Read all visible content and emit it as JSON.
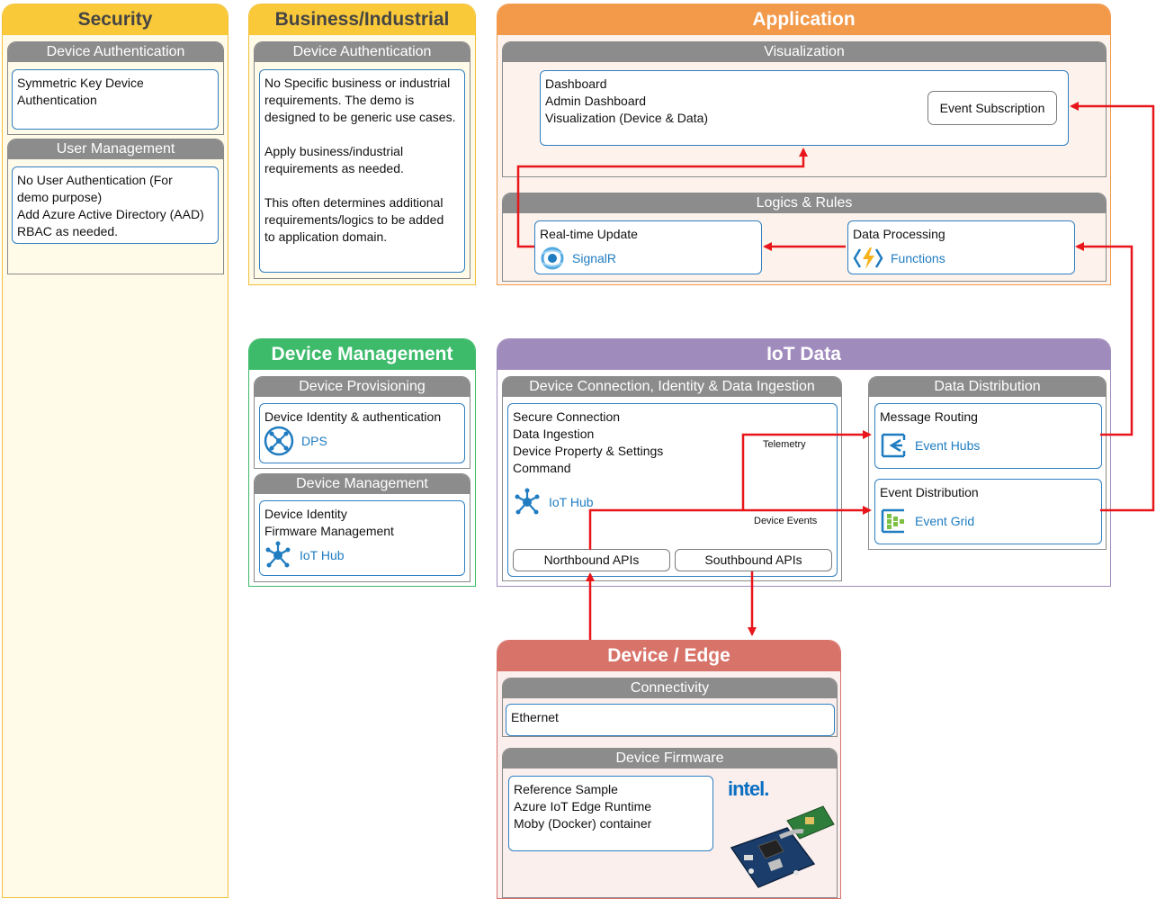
{
  "security": {
    "title": "Security",
    "device_auth": {
      "title": "Device Authentication",
      "lines": [
        "Symmetric Key Device",
        "Authentication"
      ]
    },
    "user_mgmt": {
      "title": "User Management",
      "lines": [
        "No User Authentication (For",
        "demo purpose)",
        "Add Azure Active Directory (AAD)",
        "RBAC as needed."
      ]
    }
  },
  "business": {
    "title": "Business/Industrial",
    "section_title": "Device Authentication",
    "para1": [
      "No Specific business or industrial",
      "requirements.  The demo is",
      "designed to be generic use cases."
    ],
    "para2": [
      "Apply business/industrial",
      "requirements as needed."
    ],
    "para3": [
      "This often determines additional",
      "requirements/logics to be added",
      "to application domain."
    ]
  },
  "application": {
    "title": "Application",
    "visualization": {
      "title": "Visualization",
      "lines": [
        "Dashboard",
        "Admin Dashboard",
        "Visualization (Device & Data)"
      ],
      "event_subscription": "Event Subscription"
    },
    "logics": {
      "title": "Logics & Rules",
      "realtime": {
        "title": "Real-time Update",
        "service": "SignalR"
      },
      "processing": {
        "title": "Data Processing",
        "service": "Functions"
      }
    }
  },
  "device_management": {
    "title": "Device Management",
    "provisioning": {
      "title": "Device Provisioning",
      "line": "Device Identity & authentication",
      "service": "DPS"
    },
    "management": {
      "title": "Device Management",
      "lines": [
        "Device Identity",
        "Firmware Management"
      ],
      "service": "IoT Hub"
    }
  },
  "iot_data": {
    "title": "IoT Data",
    "ingestion": {
      "title": "Device Connection, Identity & Data Ingestion",
      "lines": [
        "Secure Connection",
        "Data Ingestion",
        "Device Property & Settings",
        "Command"
      ],
      "service": "IoT Hub",
      "northbound": "Northbound APIs",
      "southbound": "Southbound APIs",
      "telemetry_label": "Telemetry",
      "device_events_label": "Device Events"
    },
    "distribution": {
      "title": "Data Distribution",
      "routing": {
        "title": "Message Routing",
        "service": "Event Hubs"
      },
      "distribution": {
        "title": "Event Distribution",
        "service": "Event Grid"
      }
    }
  },
  "device_edge": {
    "title": "Device / Edge",
    "connectivity": {
      "title": "Connectivity",
      "line": "Ethernet"
    },
    "firmware": {
      "title": "Device Firmware",
      "lines": [
        "Reference Sample",
        "Azure IoT Edge Runtime",
        "Moby (Docker) container"
      ],
      "logo_text": "intel."
    }
  },
  "colors": {
    "security_header": "#f9c93a",
    "security_bg": "#fffbe8",
    "application_header": "#f2994a",
    "application_bg": "#fdf3ec",
    "device_mgmt_header": "#3dbb6b",
    "iot_header": "#a08bbd",
    "edge_header": "#d8736a",
    "edge_bg": "#fbefee",
    "arrow": "#e8161b",
    "link": "#1f7cc0"
  }
}
